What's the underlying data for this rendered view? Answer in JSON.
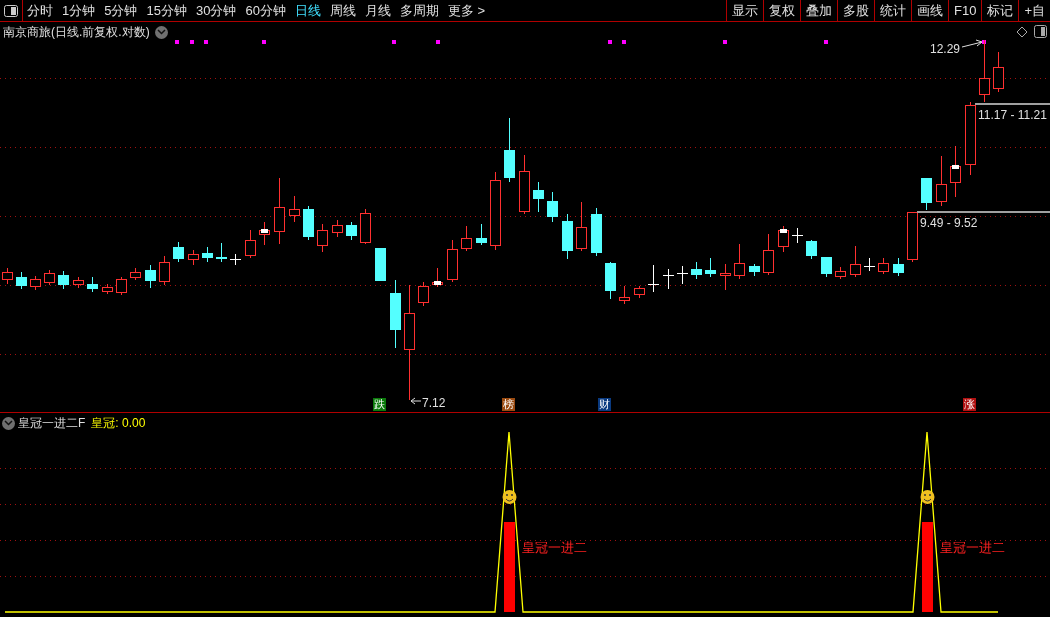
{
  "toolbar": {
    "periods": [
      {
        "label": "分时",
        "selected": false
      },
      {
        "label": "1分钟",
        "selected": false
      },
      {
        "label": "5分钟",
        "selected": false
      },
      {
        "label": "15分钟",
        "selected": false
      },
      {
        "label": "30分钟",
        "selected": false
      },
      {
        "label": "60分钟",
        "selected": false
      },
      {
        "label": "日线",
        "selected": true
      },
      {
        "label": "周线",
        "selected": false
      },
      {
        "label": "月线",
        "selected": false
      },
      {
        "label": "多周期",
        "selected": false
      },
      {
        "label": "更多 >",
        "selected": false
      }
    ],
    "actions": [
      "显示",
      "复权",
      "叠加",
      "多股",
      "统计",
      "画线",
      "F10",
      "标记",
      "+自"
    ]
  },
  "chart": {
    "title": "南京商旅(日线.前复权.对数)",
    "high_label": "12.29",
    "low_label": "7.12",
    "zones": [
      {
        "label": "11.17 - 11.21"
      },
      {
        "label": "9.49 - 9.52"
      }
    ],
    "markers": [
      {
        "label": "跌",
        "color": "#0a7a0a"
      },
      {
        "label": "榜",
        "color": "#9a4a10"
      },
      {
        "label": "财",
        "color": "#0a3a80"
      },
      {
        "label": "涨",
        "color": "#b01010"
      }
    ]
  },
  "indicator": {
    "name": "皇冠一进二F",
    "value_label": "皇冠: 0.00",
    "signals": [
      {
        "label": "皇冠一进二"
      },
      {
        "label": "皇冠一进二"
      }
    ]
  }
}
